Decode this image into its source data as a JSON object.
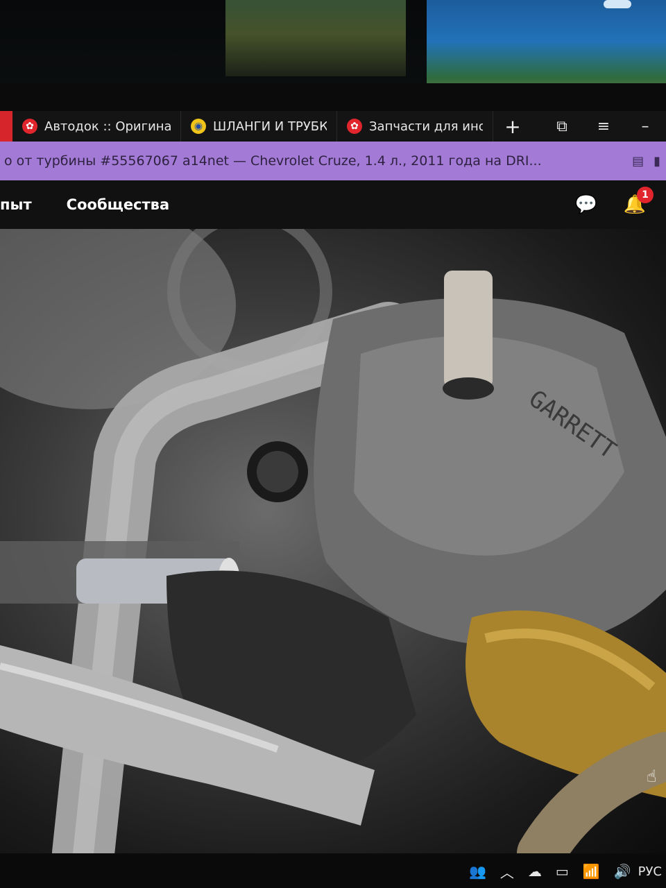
{
  "browser": {
    "tabs": [
      {
        "label": "Автодок :: Оригина",
        "icon": "autodoc-favicon"
      },
      {
        "label": "ШЛАНГИ И ТРУБКИ",
        "icon": "globe-favicon"
      },
      {
        "label": "Запчасти для ином",
        "icon": "autodoc-favicon"
      }
    ],
    "new_tab": "+",
    "url_text": "о от турбины #55567067 a14net — Chevrolet Cruze, 1.4 л., 2011 года на DRI..."
  },
  "site_nav": {
    "items": [
      "пыт",
      "Сообщества"
    ],
    "notifications_count": "1"
  },
  "photo": {
    "content": "engine-bay-turbo-pipes"
  },
  "taskbar": {
    "language": "РУС"
  },
  "colors": {
    "accent_tab": "#d6262b",
    "address_bar": "#a37bd6",
    "badge": "#e0262c"
  }
}
